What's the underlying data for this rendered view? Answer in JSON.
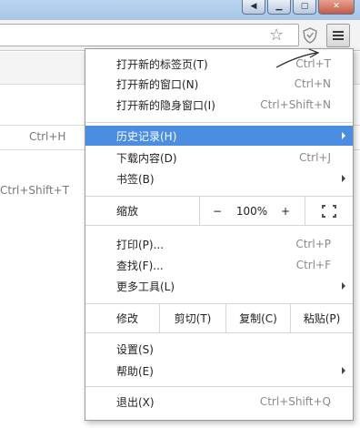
{
  "window": {
    "controls": [
      {
        "name": "back-icon",
        "glyph": "◀"
      },
      {
        "name": "minimize-icon",
        "glyph": "▁"
      },
      {
        "name": "maximize-icon",
        "glyph": "▢"
      },
      {
        "name": "close-icon",
        "glyph": "✕"
      }
    ]
  },
  "toolbar": {
    "star_icon": "☆",
    "shield_icon": "shield-icon",
    "menu_icon": "hamburger-menu-icon"
  },
  "background_page": {
    "shortcuts": [
      "Ctrl+H",
      "Ctrl+Shift+T"
    ]
  },
  "menu": {
    "new_tab": {
      "label": "打开新的标签页(T)",
      "shortcut": "Ctrl+T"
    },
    "new_window": {
      "label": "打开新的窗口(N)",
      "shortcut": "Ctrl+N"
    },
    "incognito": {
      "label": "打开新的隐身窗口(I)",
      "shortcut": "Ctrl+Shift+N"
    },
    "history": {
      "label": "历史记录(H)"
    },
    "downloads": {
      "label": "下载内容(D)",
      "shortcut": "Ctrl+J"
    },
    "bookmarks": {
      "label": "书签(B)"
    },
    "zoom": {
      "label": "缩放",
      "minus": "−",
      "value": "100%",
      "plus": "+"
    },
    "print": {
      "label": "打印(P)...",
      "shortcut": "Ctrl+P"
    },
    "find": {
      "label": "查找(F)...",
      "shortcut": "Ctrl+F"
    },
    "more_tools": {
      "label": "更多工具(L)"
    },
    "edit": {
      "label": "修改",
      "cut": "剪切(T)",
      "copy": "复制(C)",
      "paste": "粘贴(P)"
    },
    "settings": {
      "label": "设置(S)"
    },
    "help": {
      "label": "帮助(E)"
    },
    "exit": {
      "label": "退出(X)",
      "shortcut": "Ctrl+Shift+Q"
    }
  },
  "colors": {
    "highlight": "#4b8de0",
    "shortcut_text": "#8a8a8a"
  }
}
